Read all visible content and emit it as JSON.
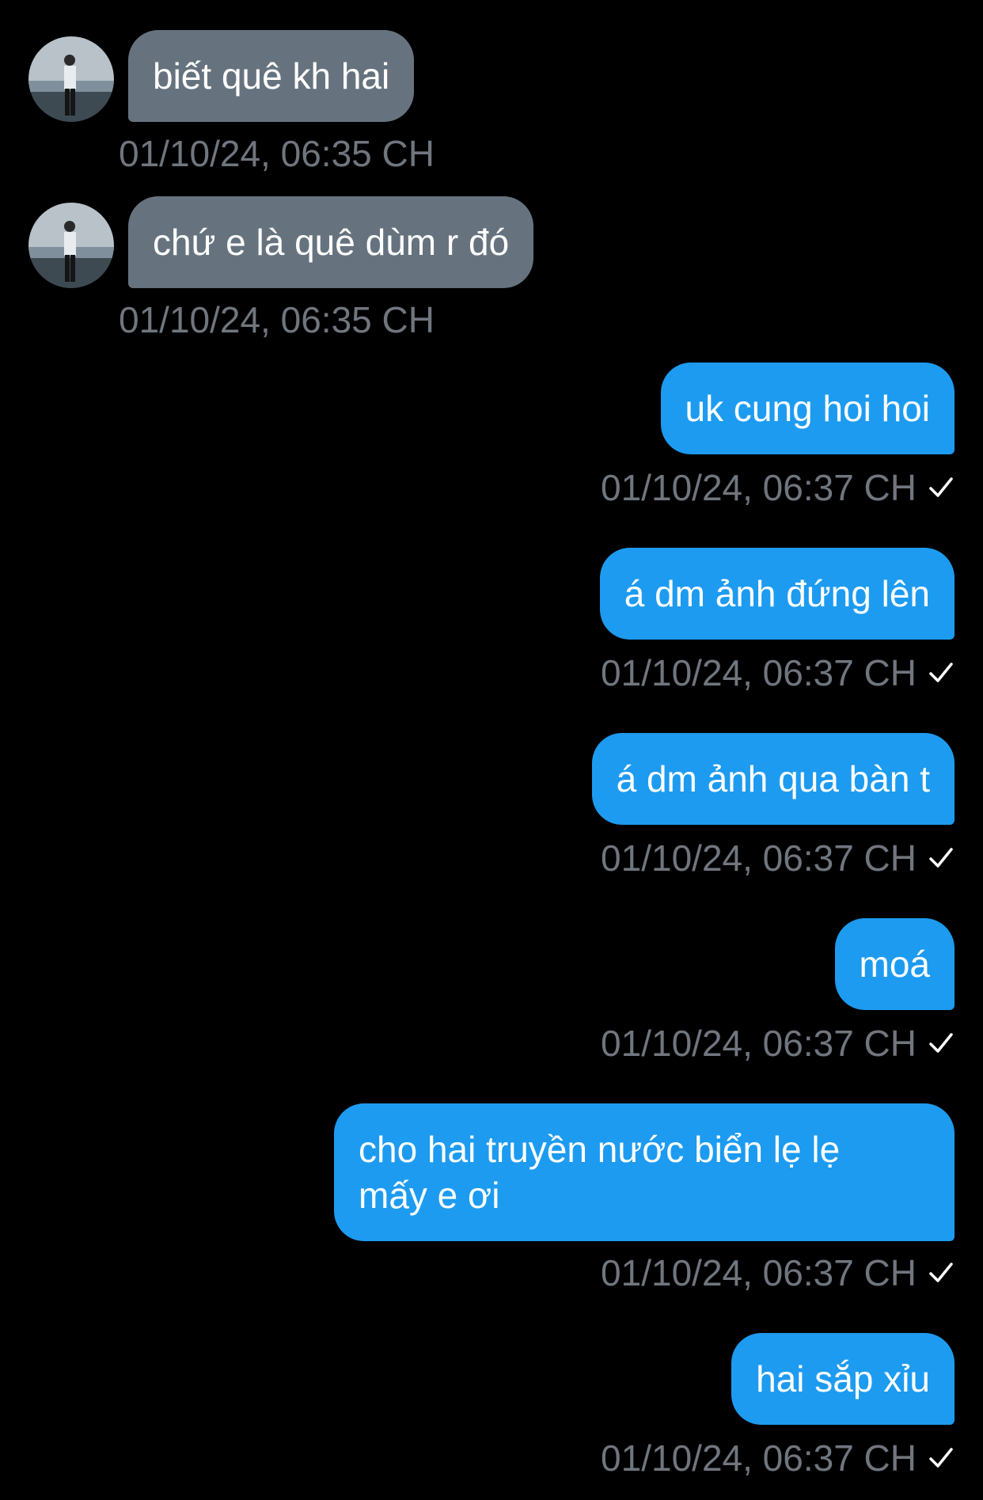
{
  "messages": [
    {
      "direction": "incoming",
      "text": "biết quê kh hai",
      "time": "01/10/24, 06:35 CH"
    },
    {
      "direction": "incoming",
      "text": "chứ e là quê dùm r đó",
      "time": "01/10/24, 06:35 CH"
    },
    {
      "direction": "outgoing",
      "text": "uk cung hoi hoi",
      "time": "01/10/24, 06:37 CH"
    },
    {
      "direction": "outgoing",
      "text": "á dm ảnh đứng lên",
      "time": "01/10/24, 06:37 CH"
    },
    {
      "direction": "outgoing",
      "text": "á dm ảnh qua bàn t",
      "time": "01/10/24, 06:37 CH"
    },
    {
      "direction": "outgoing",
      "text": "moá",
      "time": "01/10/24, 06:37 CH"
    },
    {
      "direction": "outgoing",
      "text": "cho hai truyền nước biển lẹ lẹ\nmấy e ơi",
      "time": "01/10/24, 06:37 CH"
    },
    {
      "direction": "outgoing",
      "text": "hai sắp xỉu",
      "time": "01/10/24, 06:37 CH"
    }
  ],
  "colors": {
    "background": "#000000",
    "incoming_bubble": "#66737f",
    "outgoing_bubble": "#1d9bf0",
    "timestamp": "#70767e",
    "text": "#ffffff"
  },
  "icons": {
    "avatar": "avatar-photo",
    "read_receipt": "checkmark-icon"
  }
}
